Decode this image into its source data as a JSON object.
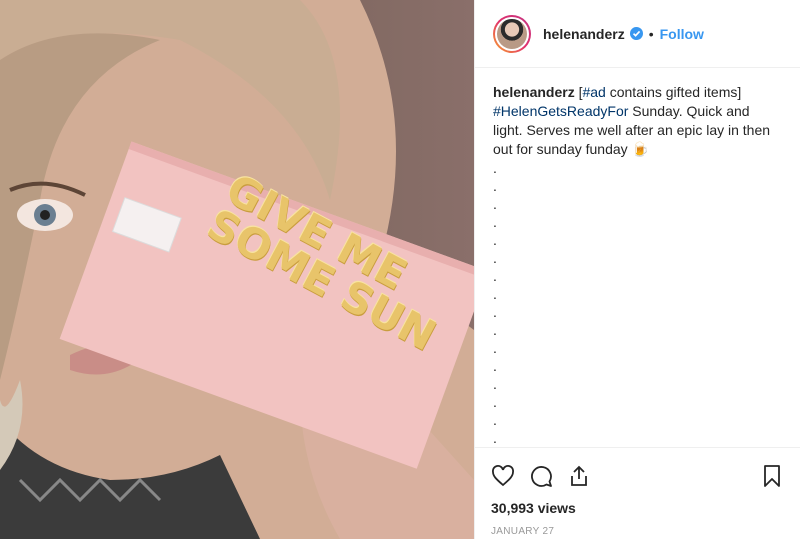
{
  "post": {
    "username": "helenanderz",
    "follow_label": "Follow",
    "caption": {
      "username": "helenanderz",
      "part1": " [",
      "hashtag_ad": "#ad",
      "part2": " contains gifted items]",
      "hashtag_ready": "#HelenGetsReadyFor",
      "part3": " Sunday. Quick and light. Serves me well after an epic lay in then out for sunday funday 🍺"
    },
    "dots": [
      ".",
      ".",
      ".",
      ".",
      ".",
      ".",
      ".",
      ".",
      ".",
      ".",
      ".",
      ".",
      ".",
      ".",
      ".",
      "."
    ],
    "views": "30,993 views",
    "date": "JANUARY 27",
    "image_text": {
      "line1": "GIVE ME",
      "line2": "SOME SUN"
    }
  },
  "colors": {
    "link": "#003569",
    "follow": "#3897f0",
    "verified": "#3897f0",
    "palette_pink": "#f2c3c1",
    "gold": "#e8c46a"
  },
  "icons": [
    "verified-badge-icon",
    "heart-icon",
    "comment-icon",
    "share-icon",
    "bookmark-icon"
  ]
}
